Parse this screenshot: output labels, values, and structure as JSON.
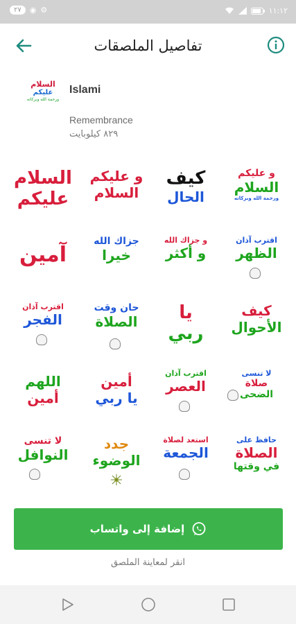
{
  "status_bar": {
    "left_badge": "٢٧",
    "time": "١١:١٢",
    "battery": "battery-icon",
    "wifi": "wifi-icon",
    "signal": "signal-icon"
  },
  "app_bar": {
    "title": "تفاصيل الملصقات",
    "back_icon": "arrow-back-icon",
    "info_icon": "info-icon"
  },
  "pack": {
    "thumb_line1": "السلام",
    "thumb_line2": "عليكم",
    "thumb_line3": "ورحمة الله وبركاته",
    "name": "Islami",
    "publisher": "Remembrance",
    "size": "٨٢٩ كيلوبايت"
  },
  "stickers": [
    {
      "lines": [
        "السلام",
        "عليكم"
      ]
    },
    {
      "lines": [
        "و عليكم",
        "السلام"
      ]
    },
    {
      "lines": [
        "كيف",
        "الحال"
      ]
    },
    {
      "lines": [
        "و عليكم",
        "السلام",
        "ورحمة الله وبركاته"
      ]
    },
    {
      "lines": [
        "آمين"
      ]
    },
    {
      "lines": [
        "جزاك الله",
        "خيرا"
      ]
    },
    {
      "lines": [
        "و جزاك الله",
        "و أكثر"
      ]
    },
    {
      "lines": [
        "اقترب آذان",
        "الظهر"
      ]
    },
    {
      "lines": [
        "اقترب آذان",
        "الفجر"
      ]
    },
    {
      "lines": [
        "حان وقت",
        "الصلاة"
      ]
    },
    {
      "lines": [
        "يا",
        "ربي"
      ]
    },
    {
      "lines": [
        "كيف",
        "الأحوال"
      ]
    },
    {
      "lines": [
        "اللهم",
        "أمين"
      ]
    },
    {
      "lines": [
        "أمين",
        "يا ربي"
      ]
    },
    {
      "lines": [
        "اقترب آذان",
        "العصر"
      ]
    },
    {
      "lines": [
        "لا تنسى",
        "صلاة",
        "الضحى"
      ]
    },
    {
      "lines": [
        "لا تنسى",
        "النوافل"
      ]
    },
    {
      "lines": [
        "جدد",
        "الوضوء"
      ]
    },
    {
      "lines": [
        "استعد لصلاة",
        "الجمعة"
      ]
    },
    {
      "lines": [
        "حافظ على",
        "الصلاة",
        "في وقتها"
      ]
    }
  ],
  "add_button": {
    "label": "إضافة إلى واتساب",
    "icon": "whatsapp-icon"
  },
  "hint": "انقر لمعاينة الملصق",
  "nav_bar": {
    "back": "nav-back-icon",
    "home": "nav-home-icon",
    "recents": "nav-recents-icon"
  },
  "colors": {
    "accent": "#3cb44b",
    "teal": "#1e8c7e",
    "sticker_red": "#d81e3c",
    "sticker_blue": "#1d56d8",
    "sticker_green": "#1ea51e"
  }
}
